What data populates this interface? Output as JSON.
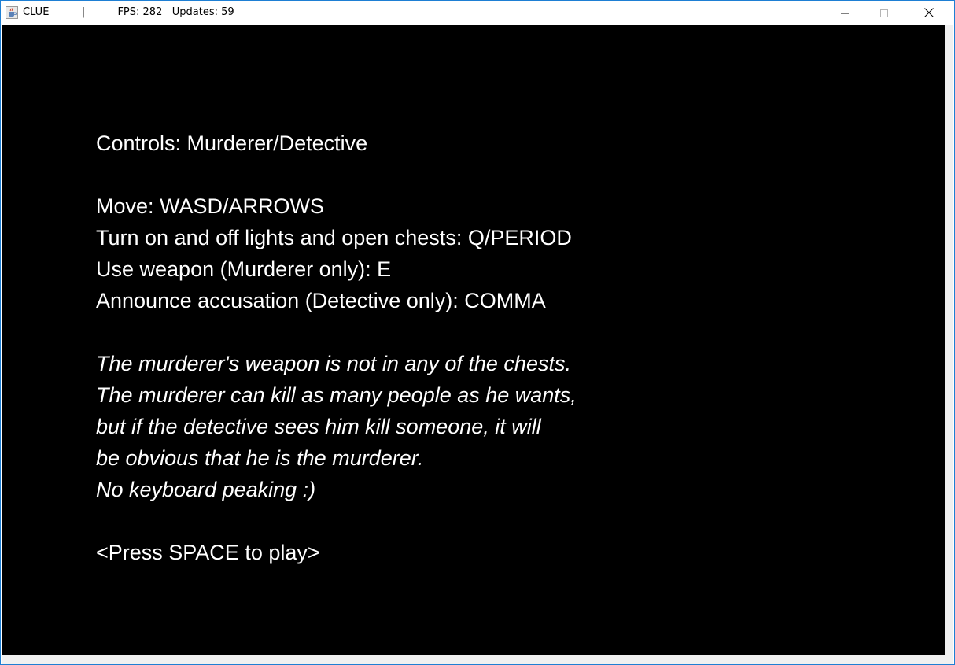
{
  "window": {
    "title": "CLUE",
    "separator": "|",
    "fps_label": "FPS: 282",
    "updates_label": "Updates: 59",
    "icons": {
      "app": "java-coffee-cup-icon",
      "minimize": "minimize-icon",
      "maximize": "maximize-icon",
      "close": "close-icon"
    }
  },
  "screen": {
    "background": "#000000",
    "text_color": "#ffffff",
    "heading": "Controls: Murderer/Detective",
    "controls": [
      "Move: WASD/ARROWS",
      "Turn on and off lights and open chests: Q/PERIOD",
      "Use weapon (Murderer only): E",
      "Announce accusation (Detective only): COMMA"
    ],
    "notes": [
      "The murderer's weapon is not in any of the chests.",
      "The murderer can kill as many people as he wants,",
      "but if the detective sees him kill someone, it will",
      "be obvious that he is the murderer.",
      "No keyboard peaking :)"
    ],
    "prompt": "<Press SPACE to play>"
  }
}
